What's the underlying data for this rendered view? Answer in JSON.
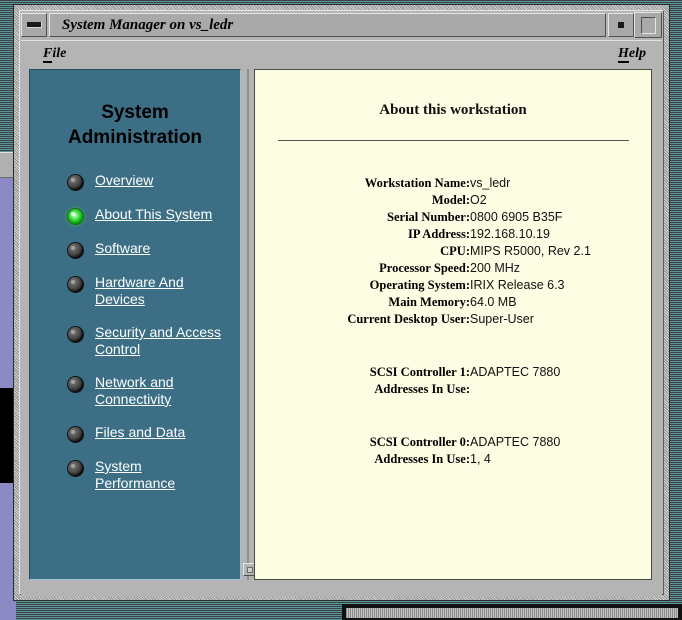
{
  "window": {
    "title": "System Manager on vs_ledr",
    "menu_button_icon": "window-menu-icon",
    "minimize_icon": "minimize-icon",
    "maximize_icon": "maximize-icon"
  },
  "menubar": {
    "file": {
      "mnemonic": "F",
      "rest": "ile"
    },
    "help": {
      "mnemonic": "H",
      "rest": "elp"
    }
  },
  "sidebar": {
    "title_line1": "System",
    "title_line2": "Administration",
    "items": [
      {
        "label": "Overview",
        "active": false,
        "bullet_icon": "gear-bullet-icon"
      },
      {
        "label": "About This System",
        "active": true,
        "bullet_icon": "gear-bullet-icon-active"
      },
      {
        "label": "Software",
        "active": false,
        "bullet_icon": "gear-bullet-icon"
      },
      {
        "label": "Hardware And Devices",
        "active": false,
        "bullet_icon": "gear-bullet-icon"
      },
      {
        "label": "Security and Access Control",
        "active": false,
        "bullet_icon": "gear-bullet-icon"
      },
      {
        "label": "Network and Connectivity",
        "active": false,
        "bullet_icon": "gear-bullet-icon"
      },
      {
        "label": "Files and Data",
        "active": false,
        "bullet_icon": "gear-bullet-icon"
      },
      {
        "label": "System Performance",
        "active": false,
        "bullet_icon": "gear-bullet-icon"
      }
    ]
  },
  "content": {
    "heading": "About this workstation",
    "rows": [
      {
        "label": "Workstation Name:",
        "value": "vs_ledr"
      },
      {
        "label": "Model:",
        "value": "O2"
      },
      {
        "label": "Serial Number:",
        "value": "0800 6905 B35F"
      },
      {
        "label": "IP Address:",
        "value": "192.168.10.19"
      },
      {
        "label": "CPU:",
        "value": "MIPS R5000, Rev 2.1"
      },
      {
        "label": "Processor Speed:",
        "value": "200 MHz"
      },
      {
        "label": "Operating System:",
        "value": "IRIX Release 6.3"
      },
      {
        "label": "Main Memory:",
        "value": "64.0 MB"
      },
      {
        "label": "Current Desktop User:",
        "value": "Super-User"
      },
      {
        "spacer": true
      },
      {
        "label": "SCSI Controller 1:",
        "value": "ADAPTEC 7880"
      },
      {
        "label": "Addresses In Use:",
        "value": ""
      },
      {
        "spacer": true
      },
      {
        "label": "SCSI Controller 0:",
        "value": "ADAPTEC 7880"
      },
      {
        "label": "Addresses In Use:",
        "value": "1, 4"
      }
    ]
  },
  "colors": {
    "sidebar_bg": "#3c6f85",
    "content_bg": "#fdfde3",
    "window_chrome": "#b4b4b4",
    "active_bullet": "#2ecc2e",
    "desktop": "#4a4a52"
  },
  "splitter": {
    "handle_icon": "resize-handle-icon"
  }
}
